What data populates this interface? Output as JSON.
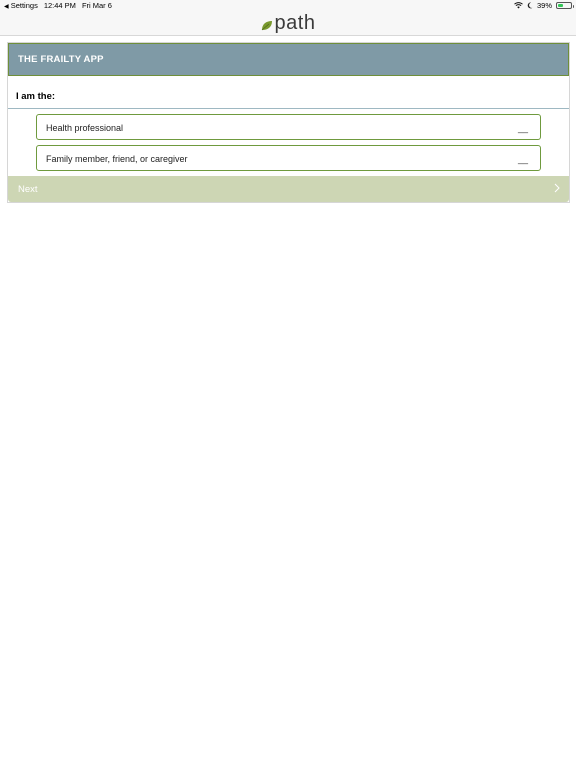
{
  "status_bar": {
    "back_label": "Settings",
    "time": "12:44 PM",
    "date": "Fri Mar 6",
    "battery": "39%",
    "battery_level": 0.39
  },
  "nav": {
    "logo_text": "path"
  },
  "app": {
    "title": "THE FRAILTY APP"
  },
  "question": {
    "prompt": "I am the:",
    "options": [
      {
        "label": "Health professional",
        "marker": "__"
      },
      {
        "label": "Family member, friend, or caregiver",
        "marker": "__"
      }
    ]
  },
  "next_button": {
    "label": "Next"
  },
  "colors": {
    "header_bg": "#7f9aa6",
    "accent_green": "#6f9a3e",
    "next_bg": "#cdd6b4"
  }
}
